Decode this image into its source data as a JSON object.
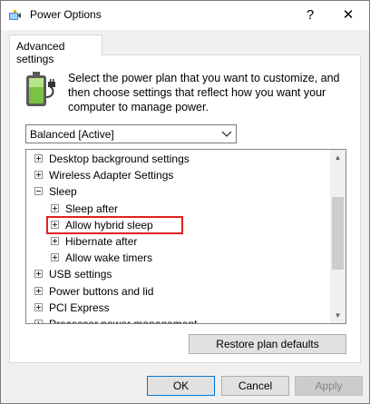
{
  "window": {
    "title": "Power Options",
    "help_glyph": "?",
    "close_glyph": "✕",
    "icon": "power-options-icon"
  },
  "tab": {
    "label": "Advanced settings"
  },
  "description": "Select the power plan that you want to customize, and then choose settings that reflect how you want your computer to manage power.",
  "plan_dropdown": {
    "selected": "Balanced [Active]"
  },
  "tree": {
    "items": [
      {
        "label": "Desktop background settings",
        "state": "collapsed",
        "level": 0
      },
      {
        "label": "Wireless Adapter Settings",
        "state": "collapsed",
        "level": 0
      },
      {
        "label": "Sleep",
        "state": "expanded",
        "level": 0
      },
      {
        "label": "Sleep after",
        "state": "collapsed",
        "level": 1
      },
      {
        "label": "Allow hybrid sleep",
        "state": "collapsed",
        "level": 1,
        "highlighted": true
      },
      {
        "label": "Hibernate after",
        "state": "collapsed",
        "level": 1
      },
      {
        "label": "Allow wake timers",
        "state": "collapsed",
        "level": 1
      },
      {
        "label": "USB settings",
        "state": "collapsed",
        "level": 0
      },
      {
        "label": "Power buttons and lid",
        "state": "collapsed",
        "level": 0
      },
      {
        "label": "PCI Express",
        "state": "collapsed",
        "level": 0
      },
      {
        "label": "Processor power management",
        "state": "collapsed",
        "level": 0
      }
    ]
  },
  "buttons": {
    "restore": "Restore plan defaults",
    "ok": "OK",
    "cancel": "Cancel",
    "apply": "Apply"
  },
  "colors": {
    "highlight_border": "#e02020",
    "default_button_border": "#0078d7"
  }
}
